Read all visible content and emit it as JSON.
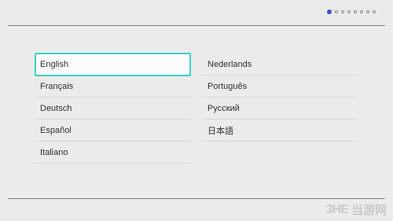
{
  "pager": {
    "total": 8,
    "current": 1
  },
  "languages": {
    "left": [
      "English",
      "Français",
      "Deutsch",
      "Español",
      "Italiano"
    ],
    "right": [
      "Nederlands",
      "Português",
      "Русский",
      "日本語"
    ]
  },
  "selected": "English",
  "colors": {
    "accent": "#3bd3c6",
    "pager_active": "#3b50c8",
    "background": "#ebebeb"
  },
  "watermark": {
    "logo": "3HE",
    "text": "当游网"
  }
}
